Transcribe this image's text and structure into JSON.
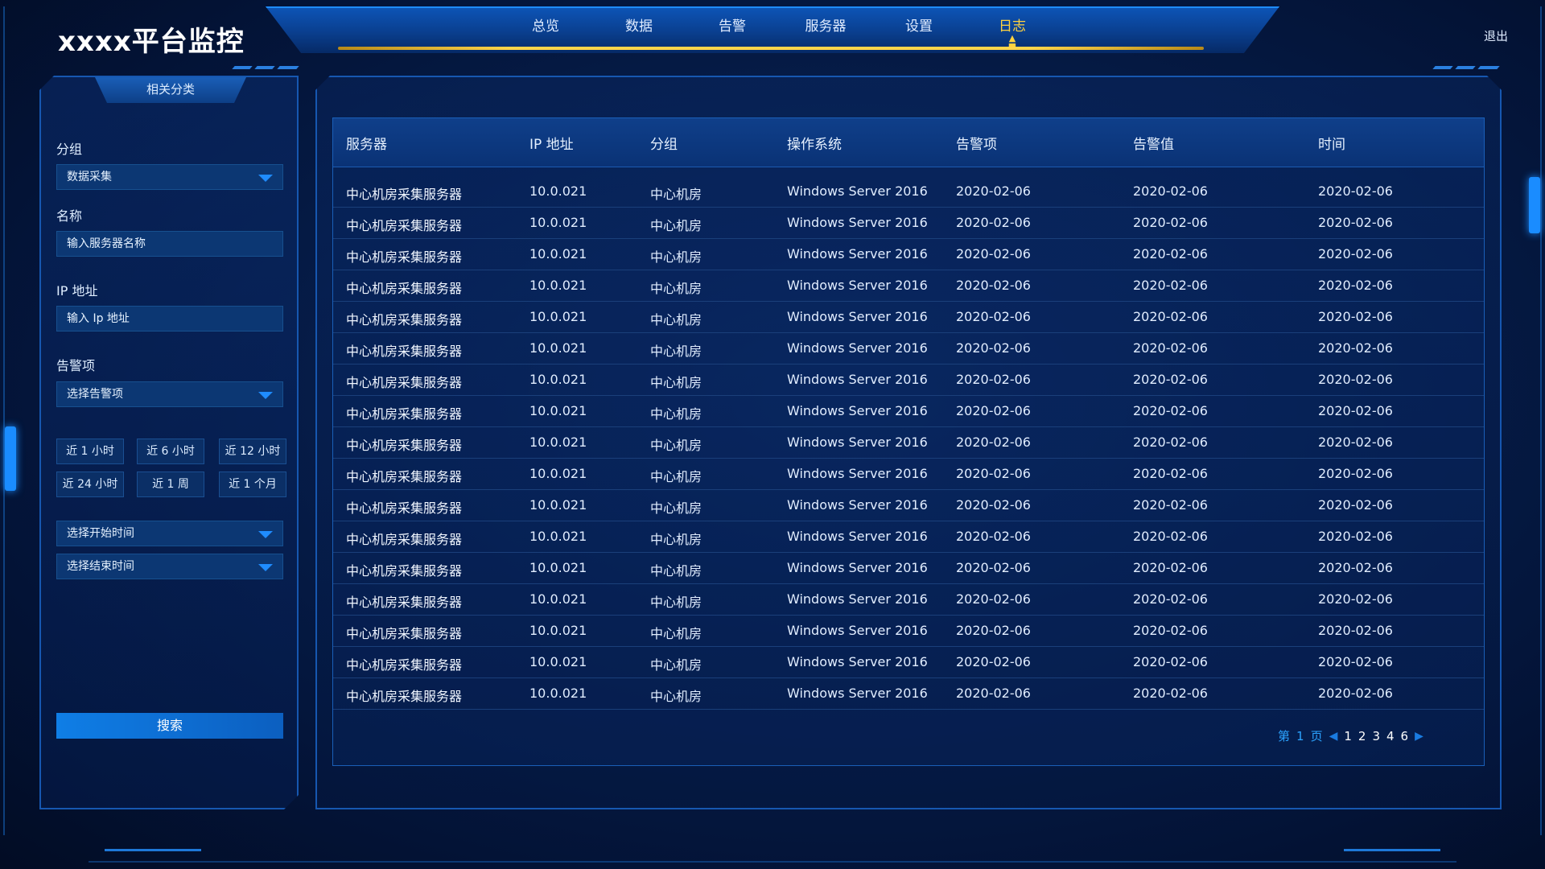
{
  "app": {
    "title": "xxxx平台监控",
    "logout": "退出"
  },
  "nav": [
    {
      "label": "总览"
    },
    {
      "label": "数据"
    },
    {
      "label": "告警"
    },
    {
      "label": "服务器"
    },
    {
      "label": "设置"
    },
    {
      "label": "日志",
      "active": true
    }
  ],
  "sidebar": {
    "title": "相关分类",
    "group_label": "分组",
    "group_value": "数据采集",
    "name_label": "名称",
    "name_placeholder": "输入服务器名称",
    "ip_label": "IP 地址",
    "ip_placeholder": "输入 Ip 地址",
    "alarm_label": "告警项",
    "alarm_placeholder": "选择告警项",
    "time_buttons": [
      "近 1 小时",
      "近 6 小时",
      "近 12 小时",
      "近 24 小时",
      "近 1 周",
      "近 1 个月"
    ],
    "start_time": "选择开始时间",
    "end_time": "选择结束时间",
    "search": "搜索"
  },
  "table": {
    "headers": [
      "服务器",
      "IP 地址",
      "分组",
      "操作系统",
      "告警项",
      "告警值",
      "时间"
    ],
    "rows": [
      [
        "中心机房采集服务器",
        "10.0.021",
        "中心机房",
        "Windows Server 2016",
        "2020-02-06",
        "2020-02-06",
        "2020-02-06"
      ],
      [
        "中心机房采集服务器",
        "10.0.021",
        "中心机房",
        "Windows Server 2016",
        "2020-02-06",
        "2020-02-06",
        "2020-02-06"
      ],
      [
        "中心机房采集服务器",
        "10.0.021",
        "中心机房",
        "Windows Server 2016",
        "2020-02-06",
        "2020-02-06",
        "2020-02-06"
      ],
      [
        "中心机房采集服务器",
        "10.0.021",
        "中心机房",
        "Windows Server 2016",
        "2020-02-06",
        "2020-02-06",
        "2020-02-06"
      ],
      [
        "中心机房采集服务器",
        "10.0.021",
        "中心机房",
        "Windows Server 2016",
        "2020-02-06",
        "2020-02-06",
        "2020-02-06"
      ],
      [
        "中心机房采集服务器",
        "10.0.021",
        "中心机房",
        "Windows Server 2016",
        "2020-02-06",
        "2020-02-06",
        "2020-02-06"
      ],
      [
        "中心机房采集服务器",
        "10.0.021",
        "中心机房",
        "Windows Server 2016",
        "2020-02-06",
        "2020-02-06",
        "2020-02-06"
      ],
      [
        "中心机房采集服务器",
        "10.0.021",
        "中心机房",
        "Windows Server 2016",
        "2020-02-06",
        "2020-02-06",
        "2020-02-06"
      ],
      [
        "中心机房采集服务器",
        "10.0.021",
        "中心机房",
        "Windows Server 2016",
        "2020-02-06",
        "2020-02-06",
        "2020-02-06"
      ],
      [
        "中心机房采集服务器",
        "10.0.021",
        "中心机房",
        "Windows Server 2016",
        "2020-02-06",
        "2020-02-06",
        "2020-02-06"
      ],
      [
        "中心机房采集服务器",
        "10.0.021",
        "中心机房",
        "Windows Server 2016",
        "2020-02-06",
        "2020-02-06",
        "2020-02-06"
      ],
      [
        "中心机房采集服务器",
        "10.0.021",
        "中心机房",
        "Windows Server 2016",
        "2020-02-06",
        "2020-02-06",
        "2020-02-06"
      ],
      [
        "中心机房采集服务器",
        "10.0.021",
        "中心机房",
        "Windows Server 2016",
        "2020-02-06",
        "2020-02-06",
        "2020-02-06"
      ],
      [
        "中心机房采集服务器",
        "10.0.021",
        "中心机房",
        "Windows Server 2016",
        "2020-02-06",
        "2020-02-06",
        "2020-02-06"
      ],
      [
        "中心机房采集服务器",
        "10.0.021",
        "中心机房",
        "Windows Server 2016",
        "2020-02-06",
        "2020-02-06",
        "2020-02-06"
      ],
      [
        "中心机房采集服务器",
        "10.0.021",
        "中心机房",
        "Windows Server 2016",
        "2020-02-06",
        "2020-02-06",
        "2020-02-06"
      ],
      [
        "中心机房采集服务器",
        "10.0.021",
        "中心机房",
        "Windows Server 2016",
        "2020-02-06",
        "2020-02-06",
        "2020-02-06"
      ]
    ]
  },
  "pager": {
    "prefix": "第",
    "current": "1",
    "suffix": "页",
    "pages": [
      "1",
      "2",
      "3",
      "4",
      "6"
    ]
  },
  "colors": {
    "accent": "#1f8cff",
    "active_nav": "#ffd23f",
    "background": "#021233"
  }
}
